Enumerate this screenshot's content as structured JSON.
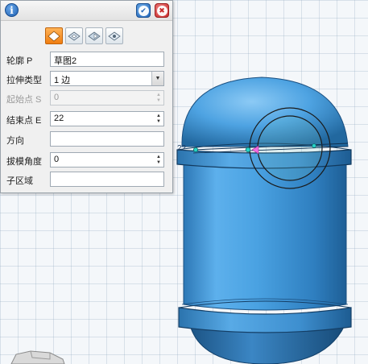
{
  "dialog": {
    "rows": [
      {
        "label": "轮廓 P",
        "value": "草图2",
        "kind": "text"
      },
      {
        "label": "拉伸类型",
        "value": "1 边",
        "kind": "dropdown"
      },
      {
        "label": "起始点 S",
        "value": "0",
        "kind": "spin",
        "disabled": true
      },
      {
        "label": "结束点 E",
        "value": "22",
        "kind": "spin"
      },
      {
        "label": "方向",
        "value": "",
        "kind": "text"
      },
      {
        "label": "拔模角度",
        "value": "0",
        "kind": "spin"
      },
      {
        "label": "子区域",
        "value": "",
        "kind": "text"
      }
    ],
    "modes": [
      {
        "name": "extrude-add-icon",
        "active": true
      },
      {
        "name": "extrude-cut-icon",
        "active": false
      },
      {
        "name": "extrude-intersect-icon",
        "active": false
      },
      {
        "name": "extrude-new-icon",
        "active": false
      }
    ]
  },
  "viewport": {
    "dimension_label": "22"
  },
  "colors": {
    "model_blue": "#4a9fde",
    "accent_orange": "#f07d10",
    "ok_blue": "#1e63b8",
    "cancel_red": "#c92a2a"
  }
}
